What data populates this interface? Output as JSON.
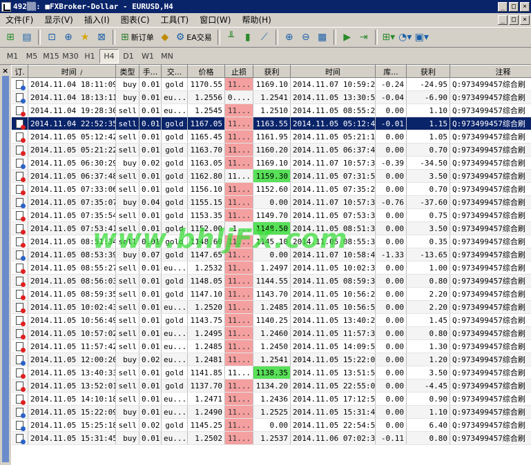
{
  "window": {
    "title": "492▒▒: ■FXBroker-Dollar - EURUSD,H4",
    "controls": [
      "_",
      "□",
      "×"
    ]
  },
  "menu": {
    "items": [
      "文件(F)",
      "显示(V)",
      "插入(I)",
      "图表(C)",
      "工具(T)",
      "窗口(W)",
      "帮助(H)"
    ],
    "mdi_controls": [
      "_",
      "□",
      "×"
    ]
  },
  "toolbar": {
    "new_order_label": "新订单",
    "ea_trading_label": "EA交易",
    "icons": [
      "new-chart-icon",
      "profiles-icon",
      "navigator-icon",
      "crosshair-icon",
      "favorites-icon",
      "history-icon",
      "new-order-icon",
      "gold-icon",
      "ea-trading-icon",
      "bar-chart-icon",
      "candlestick-icon",
      "line-chart-icon",
      "zoom-in-icon",
      "zoom-out-icon",
      "tile-icon",
      "autoscroll-icon",
      "chart-shift-icon",
      "indicators-icon",
      "periods-icon",
      "templates-icon"
    ]
  },
  "periods": {
    "items": [
      "M1",
      "M5",
      "M15",
      "M30",
      "H1",
      "H4",
      "D1",
      "W1",
      "MN"
    ],
    "active": "H4"
  },
  "table": {
    "headers": [
      "订.",
      "时间",
      "类型",
      "手...",
      "交...",
      "价格",
      "止损",
      "获利",
      "时间",
      "库...",
      "获利",
      "注释"
    ],
    "sort_indicator": "/",
    "rows": [
      {
        "icon": "blue",
        "open_time": "2014.11.04 18:11:09",
        "type": "buy",
        "lots": "0.01",
        "symbol": "gold",
        "price": "1170.55",
        "sl": "11...",
        "sl_hl": "red",
        "tp": "1169.10",
        "tp_hl": "",
        "close_time": "2014.11.07 10:59:23",
        "swap": "-0.24",
        "profit": "-24.95",
        "comment": "Q:973499457综合刷"
      },
      {
        "icon": "blue",
        "open_time": "2014.11.04 18:13:11",
        "type": "buy",
        "lots": "0.01",
        "symbol": "eu...",
        "price": "1.2556",
        "sl": "0....",
        "sl_hl": "",
        "tp": "1.2541",
        "tp_hl": "",
        "close_time": "2014.11.05 13:30:50",
        "swap": "-0.04",
        "profit": "-6.90",
        "comment": "Q:973499457综合刷"
      },
      {
        "icon": "red",
        "open_time": "2014.11.04 19:28:30",
        "type": "sell",
        "lots": "0.01",
        "symbol": "eu...",
        "price": "1.2545",
        "sl": "11...",
        "sl_hl": "red",
        "tp": "1.2510",
        "tp_hl": "",
        "close_time": "2014.11.05 08:55:24",
        "swap": "0.00",
        "profit": "1.10",
        "comment": "Q:973499457综合刷"
      },
      {
        "icon": "red",
        "open_time": "2014.11.04 22:52:35",
        "type": "sell",
        "lots": "0.01",
        "symbol": "gold",
        "price": "1167.05",
        "sl": "11...",
        "sl_hl": "red",
        "tp": "1163.55",
        "tp_hl": "",
        "close_time": "2014.11.05 05:12:40",
        "swap": "-0.01",
        "profit": "1.15",
        "comment": "Q:973499457综合刷",
        "selected": true
      },
      {
        "icon": "red",
        "open_time": "2014.11.05 05:12:42",
        "type": "sell",
        "lots": "0.01",
        "symbol": "gold",
        "price": "1165.45",
        "sl": "11...",
        "sl_hl": "red",
        "tp": "1161.95",
        "tp_hl": "",
        "close_time": "2014.11.05 05:21:19",
        "swap": "0.00",
        "profit": "1.05",
        "comment": "Q:973499457综合刷"
      },
      {
        "icon": "red",
        "open_time": "2014.11.05 05:21:22",
        "type": "sell",
        "lots": "0.01",
        "symbol": "gold",
        "price": "1163.70",
        "sl": "11...",
        "sl_hl": "red",
        "tp": "1160.20",
        "tp_hl": "",
        "close_time": "2014.11.05 06:37:46",
        "swap": "0.00",
        "profit": "0.70",
        "comment": "Q:973499457综合刷"
      },
      {
        "icon": "blue",
        "open_time": "2014.11.05 06:30:29",
        "type": "buy",
        "lots": "0.02",
        "symbol": "gold",
        "price": "1163.05",
        "sl": "11...",
        "sl_hl": "red",
        "tp": "1169.10",
        "tp_hl": "",
        "close_time": "2014.11.07 10:57:35",
        "swap": "-0.39",
        "profit": "-34.50",
        "comment": "Q:973499457综合刷"
      },
      {
        "icon": "red",
        "open_time": "2014.11.05 06:37:48",
        "type": "sell",
        "lots": "0.01",
        "symbol": "gold",
        "price": "1162.80",
        "sl": "11...",
        "sl_hl": "",
        "tp": "1159.30",
        "tp_hl": "green",
        "close_time": "2014.11.05 07:31:52",
        "swap": "0.00",
        "profit": "3.50",
        "comment": "Q:973499457综合刷"
      },
      {
        "icon": "red",
        "open_time": "2014.11.05 07:33:06",
        "type": "sell",
        "lots": "0.01",
        "symbol": "gold",
        "price": "1156.10",
        "sl": "11...",
        "sl_hl": "red",
        "tp": "1152.60",
        "tp_hl": "",
        "close_time": "2014.11.05 07:35:20",
        "swap": "0.00",
        "profit": "0.70",
        "comment": "Q:973499457综合刷"
      },
      {
        "icon": "blue",
        "open_time": "2014.11.05 07:35:07",
        "type": "buy",
        "lots": "0.04",
        "symbol": "gold",
        "price": "1155.15",
        "sl": "11...",
        "sl_hl": "red",
        "tp": "0.00",
        "tp_hl": "",
        "close_time": "2014.11.07 10:57:35",
        "swap": "-0.76",
        "profit": "-37.60",
        "comment": "Q:973499457综合刷"
      },
      {
        "icon": "red",
        "open_time": "2014.11.05 07:35:54",
        "type": "sell",
        "lots": "0.01",
        "symbol": "gold",
        "price": "1153.35",
        "sl": "11...",
        "sl_hl": "red",
        "tp": "1149.70",
        "tp_hl": "",
        "close_time": "2014.11.05 07:53:39",
        "swap": "0.00",
        "profit": "0.75",
        "comment": "Q:973499457综合刷"
      },
      {
        "icon": "red",
        "open_time": "2014.11.05 07:53:41",
        "type": "sell",
        "lots": "0.01",
        "symbol": "gold",
        "price": "1152.00",
        "sl": "1...",
        "sl_hl": "",
        "tp": "1148.50",
        "tp_hl": "green",
        "close_time": "2014.11.05 08:51:31",
        "swap": "0.00",
        "profit": "3.50",
        "comment": "Q:973499457综合刷"
      },
      {
        "icon": "red",
        "open_time": "2014.11.05 08:51:34",
        "type": "sell",
        "lots": "0.01",
        "symbol": "gold",
        "price": "1148.60",
        "sl": "11...",
        "sl_hl": "red",
        "tp": "1145.10",
        "tp_hl": "",
        "close_time": "2014.11.05 08:55:36",
        "swap": "0.00",
        "profit": "0.35",
        "comment": "Q:973499457综合刷"
      },
      {
        "icon": "blue",
        "open_time": "2014.11.05 08:53:39",
        "type": "buy",
        "lots": "0.07",
        "symbol": "gold",
        "price": "1147.65",
        "sl": "11...",
        "sl_hl": "red",
        "tp": "0.00",
        "tp_hl": "",
        "close_time": "2014.11.07 10:58:40",
        "swap": "-1.33",
        "profit": "-13.65",
        "comment": "Q:973499457综合刷"
      },
      {
        "icon": "red",
        "open_time": "2014.11.05 08:55:27",
        "type": "sell",
        "lots": "0.01",
        "symbol": "eu...",
        "price": "1.2532",
        "sl": "11...",
        "sl_hl": "red",
        "tp": "1.2497",
        "tp_hl": "",
        "close_time": "2014.11.05 10:02:39",
        "swap": "0.00",
        "profit": "1.00",
        "comment": "Q:973499457综合刷"
      },
      {
        "icon": "red",
        "open_time": "2014.11.05 08:56:03",
        "type": "sell",
        "lots": "0.01",
        "symbol": "gold",
        "price": "1148.05",
        "sl": "11...",
        "sl_hl": "red",
        "tp": "1144.55",
        "tp_hl": "",
        "close_time": "2014.11.05 08:59:32",
        "swap": "0.00",
        "profit": "0.80",
        "comment": "Q:973499457综合刷"
      },
      {
        "icon": "red",
        "open_time": "2014.11.05 08:59:35",
        "type": "sell",
        "lots": "0.01",
        "symbol": "gold",
        "price": "1147.10",
        "sl": "11...",
        "sl_hl": "red",
        "tp": "1143.70",
        "tp_hl": "",
        "close_time": "2014.11.05 10:56:28",
        "swap": "0.00",
        "profit": "2.20",
        "comment": "Q:973499457综合刷"
      },
      {
        "icon": "red",
        "open_time": "2014.11.05 10:02:43",
        "type": "sell",
        "lots": "0.01",
        "symbol": "eu...",
        "price": "1.2520",
        "sl": "11...",
        "sl_hl": "red",
        "tp": "1.2485",
        "tp_hl": "",
        "close_time": "2014.11.05 10:56:58",
        "swap": "0.00",
        "profit": "2.20",
        "comment": "Q:973499457综合刷"
      },
      {
        "icon": "red",
        "open_time": "2014.11.05 10:56:49",
        "type": "sell",
        "lots": "0.01",
        "symbol": "gold",
        "price": "1143.75",
        "sl": "11...",
        "sl_hl": "red",
        "tp": "1140.25",
        "tp_hl": "",
        "close_time": "2014.11.05 13:40:22",
        "swap": "0.00",
        "profit": "1.45",
        "comment": "Q:973499457综合刷"
      },
      {
        "icon": "red",
        "open_time": "2014.11.05 10:57:02",
        "type": "sell",
        "lots": "0.01",
        "symbol": "eu...",
        "price": "1.2495",
        "sl": "11...",
        "sl_hl": "red",
        "tp": "1.2460",
        "tp_hl": "",
        "close_time": "2014.11.05 11:57:36",
        "swap": "0.00",
        "profit": "0.80",
        "comment": "Q:973499457综合刷"
      },
      {
        "icon": "red",
        "open_time": "2014.11.05 11:57:42",
        "type": "sell",
        "lots": "0.01",
        "symbol": "eu...",
        "price": "1.2485",
        "sl": "11...",
        "sl_hl": "red",
        "tp": "1.2450",
        "tp_hl": "",
        "close_time": "2014.11.05 14:09:50",
        "swap": "0.00",
        "profit": "1.30",
        "comment": "Q:973499457综合刷"
      },
      {
        "icon": "blue",
        "open_time": "2014.11.05 12:00:20",
        "type": "buy",
        "lots": "0.02",
        "symbol": "eu...",
        "price": "1.2481",
        "sl": "11...",
        "sl_hl": "red",
        "tp": "1.2541",
        "tp_hl": "",
        "close_time": "2014.11.05 15:22:07",
        "swap": "0.00",
        "profit": "1.20",
        "comment": "Q:973499457综合刷"
      },
      {
        "icon": "red",
        "open_time": "2014.11.05 13:40:33",
        "type": "sell",
        "lots": "0.01",
        "symbol": "gold",
        "price": "1141.85",
        "sl": "11...",
        "sl_hl": "",
        "tp": "1138.35",
        "tp_hl": "green",
        "close_time": "2014.11.05 13:51:52",
        "swap": "0.00",
        "profit": "3.50",
        "comment": "Q:973499457综合刷"
      },
      {
        "icon": "red",
        "open_time": "2014.11.05 13:52:01",
        "type": "sell",
        "lots": "0.01",
        "symbol": "gold",
        "price": "1137.70",
        "sl": "11...",
        "sl_hl": "red",
        "tp": "1134.20",
        "tp_hl": "",
        "close_time": "2014.11.05 22:55:05",
        "swap": "0.00",
        "profit": "-4.45",
        "comment": "Q:973499457综合刷"
      },
      {
        "icon": "red",
        "open_time": "2014.11.05 14:10:18",
        "type": "sell",
        "lots": "0.01",
        "symbol": "eu...",
        "price": "1.2471",
        "sl": "11...",
        "sl_hl": "red",
        "tp": "1.2436",
        "tp_hl": "",
        "close_time": "2014.11.05 17:12:58",
        "swap": "0.00",
        "profit": "0.90",
        "comment": "Q:973499457综合刷"
      },
      {
        "icon": "blue",
        "open_time": "2014.11.05 15:22:09",
        "type": "buy",
        "lots": "0.01",
        "symbol": "eu...",
        "price": "1.2490",
        "sl": "11...",
        "sl_hl": "red",
        "tp": "1.2525",
        "tp_hl": "",
        "close_time": "2014.11.05 15:31:40",
        "swap": "0.00",
        "profit": "1.10",
        "comment": "Q:973499457综合刷"
      },
      {
        "icon": "blue",
        "open_time": "2014.11.05 15:25:18",
        "type": "sell",
        "lots": "0.02",
        "symbol": "gold",
        "price": "1145.25",
        "sl": "11...",
        "sl_hl": "red",
        "tp": "0.00",
        "tp_hl": "",
        "close_time": "2014.11.05 22:54:59",
        "swap": "0.00",
        "profit": "6.40",
        "comment": "Q:973499457综合刷"
      },
      {
        "icon": "blue",
        "open_time": "2014.11.05 15:31:45",
        "type": "buy",
        "lots": "0.01",
        "symbol": "eu...",
        "price": "1.2502",
        "sl": "11...",
        "sl_hl": "red",
        "tp": "1.2537",
        "tp_hl": "",
        "close_time": "2014.11.06 07:02:37",
        "swap": "-0.11",
        "profit": "0.80",
        "comment": "Q:973499457综合刷"
      }
    ]
  },
  "watermark": "www.bhljFX.com",
  "colors": {
    "titlebar": "#0a246a",
    "selected_row": "#0a246a",
    "stoploss_highlight": "#f4a0a0",
    "takeprofit_highlight": "#58e058",
    "watermark": "#3cdc3c"
  }
}
